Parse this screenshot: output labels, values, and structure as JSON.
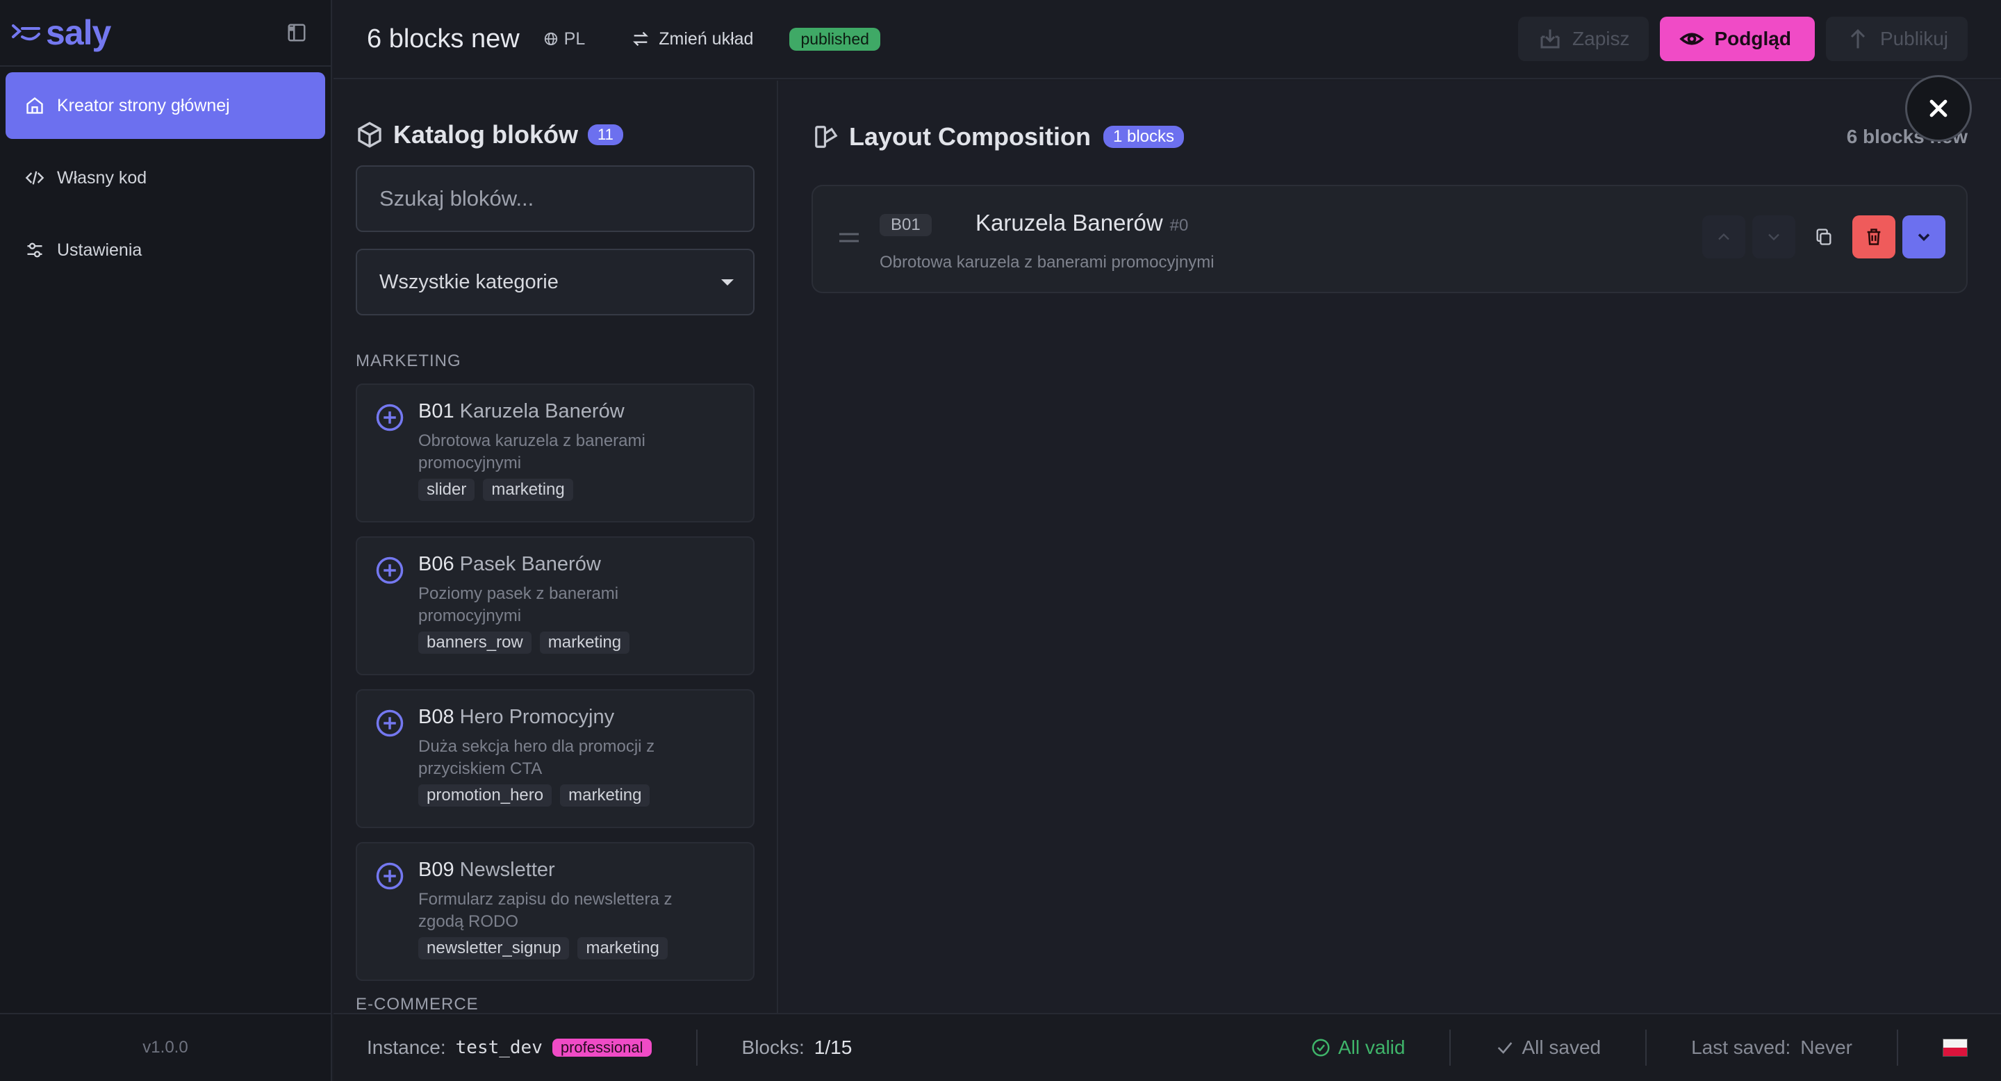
{
  "app": {
    "logo_text": "saly",
    "version": "v1.0.0"
  },
  "sidebar": {
    "items": [
      {
        "label": "Kreator strony głównej",
        "icon": "home-icon",
        "active": true
      },
      {
        "label": "Własny kod",
        "icon": "code-icon",
        "active": false
      },
      {
        "label": "Ustawienia",
        "icon": "sliders-icon",
        "active": false
      }
    ]
  },
  "topbar": {
    "page_name": "6 blocks new",
    "language": "PL",
    "switch_layout_label": "Zmień układ",
    "status": "published",
    "save_label": "Zapisz",
    "preview_label": "Podgląd",
    "publish_label": "Publikuj"
  },
  "catalog": {
    "title": "Katalog bloków",
    "count": "11",
    "search_placeholder": "Szukaj bloków...",
    "category_selected": "Wszystkie kategorie",
    "categories": [
      {
        "name": "MARKETING",
        "blocks": [
          {
            "code": "B01",
            "name": "Karuzela Banerów",
            "desc": "Obrotowa karuzela z banerami promocyjnymi",
            "tags": [
              "slider",
              "marketing"
            ]
          },
          {
            "code": "B06",
            "name": "Pasek Banerów",
            "desc": "Poziomy pasek z banerami promocyjnymi",
            "tags": [
              "banners_row",
              "marketing"
            ]
          },
          {
            "code": "B08",
            "name": "Hero Promocyjny",
            "desc": "Duża sekcja hero dla promocji z przyciskiem CTA",
            "tags": [
              "promotion_hero",
              "marketing"
            ]
          },
          {
            "code": "B09",
            "name": "Newsletter",
            "desc": "Formularz zapisu do newslettera z zgodą RODO",
            "tags": [
              "newsletter_signup",
              "marketing"
            ]
          }
        ]
      },
      {
        "name": "E-COMMERCE",
        "blocks": []
      }
    ]
  },
  "composition": {
    "title": "Layout Composition",
    "badge": "1 blocks",
    "meta": "6 blocks new",
    "items": [
      {
        "code": "B01",
        "name": "Karuzela Banerów",
        "index": "#0",
        "desc": "Obrotowa karuzela z banerami promocyjnymi"
      }
    ]
  },
  "statusbar": {
    "instance_label": "Instance:",
    "instance_value": "test_dev",
    "plan": "professional",
    "blocks_label": "Blocks:",
    "blocks_value": "1/15",
    "valid_label": "All valid",
    "saved_label": "All saved",
    "last_saved_label": "Last saved:",
    "last_saved_value": "Never"
  },
  "colors": {
    "accent": "#6c70ef",
    "pink": "#f04bc6",
    "danger": "#ef5b5b",
    "success": "#3fb56a",
    "background": "#1b1d24"
  }
}
